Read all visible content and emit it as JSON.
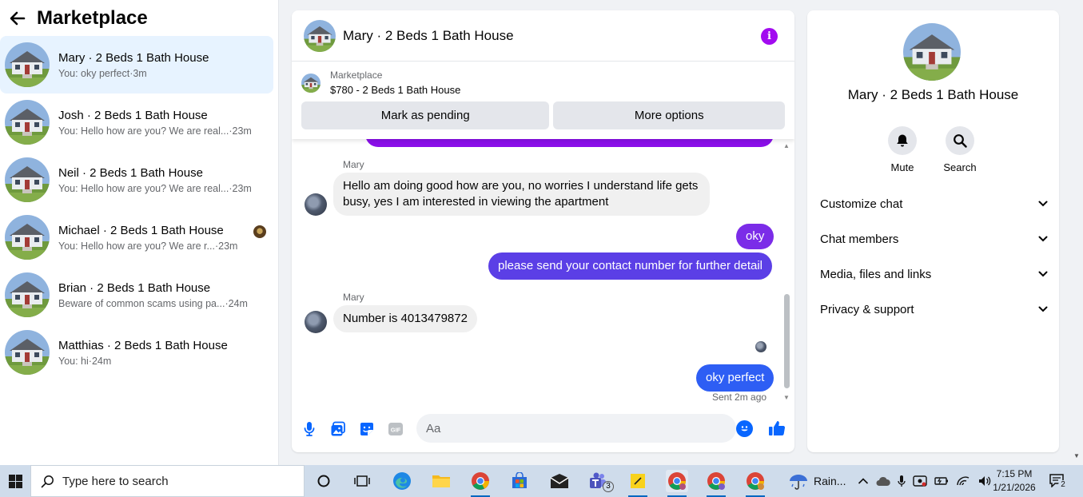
{
  "sidebar": {
    "title": "Marketplace",
    "conversations": [
      {
        "name": "Mary · 2 Beds 1 Bath House",
        "preview": "You: oky perfect",
        "time": "·3m"
      },
      {
        "name": "Josh · 2 Beds 1 Bath House",
        "preview": "You: Hello how are you? We are real...",
        "time": "·23m"
      },
      {
        "name": "Neil · 2 Beds 1 Bath House",
        "preview": "You: Hello how are you? We are real...",
        "time": "·23m"
      },
      {
        "name": "Michael · 2 Beds 1 Bath House",
        "preview": "You: Hello how are you? We are r...",
        "time": "·23m"
      },
      {
        "name": "Brian · 2 Beds 1 Bath House",
        "preview": "Beware of common scams using pa...",
        "time": "·24m"
      },
      {
        "name": "Matthias · 2 Beds 1 Bath House",
        "preview": "You: hi",
        "time": "·24m"
      }
    ]
  },
  "chat": {
    "title": "Mary · 2 Beds 1 Bath House",
    "listing": {
      "label": "Marketplace",
      "price_title": "$780 - 2 Beds 1 Bath House",
      "pending_button": "Mark as pending",
      "more_button": "More options"
    },
    "messages": [
      {
        "sender": "Mary",
        "text": "Hello am doing good how are you, no worries I understand life gets busy, yes I am interested in viewing the apartment"
      },
      {
        "text": "oky"
      },
      {
        "text": "please send your contact number for further detail"
      },
      {
        "sender": "Mary",
        "text": "Number is 4013479872"
      },
      {
        "text": "oky perfect"
      }
    ],
    "sent_status": "Sent 2m ago",
    "composer": {
      "placeholder": "Aa"
    }
  },
  "info_panel": {
    "name": "Mary · 2 Beds 1 Bath House",
    "actions": [
      {
        "label": "Mute"
      },
      {
        "label": "Search"
      }
    ],
    "sections": [
      "Customize chat",
      "Chat members",
      "Media, files and links",
      "Privacy & support"
    ]
  },
  "taskbar": {
    "search_placeholder": "Type here to search",
    "teams_badge": "3",
    "weather": "Rain...",
    "time": "7:15 PM",
    "date": "1/21/2026",
    "notification_count": "2"
  },
  "colors": {
    "outgoing_purple": "#7b2ce8",
    "outgoing_violet": "#5b3fe6",
    "outgoing_blue": "#2e5ef4",
    "active_conversation": "#e7f3ff",
    "accent": "#0866ff"
  }
}
